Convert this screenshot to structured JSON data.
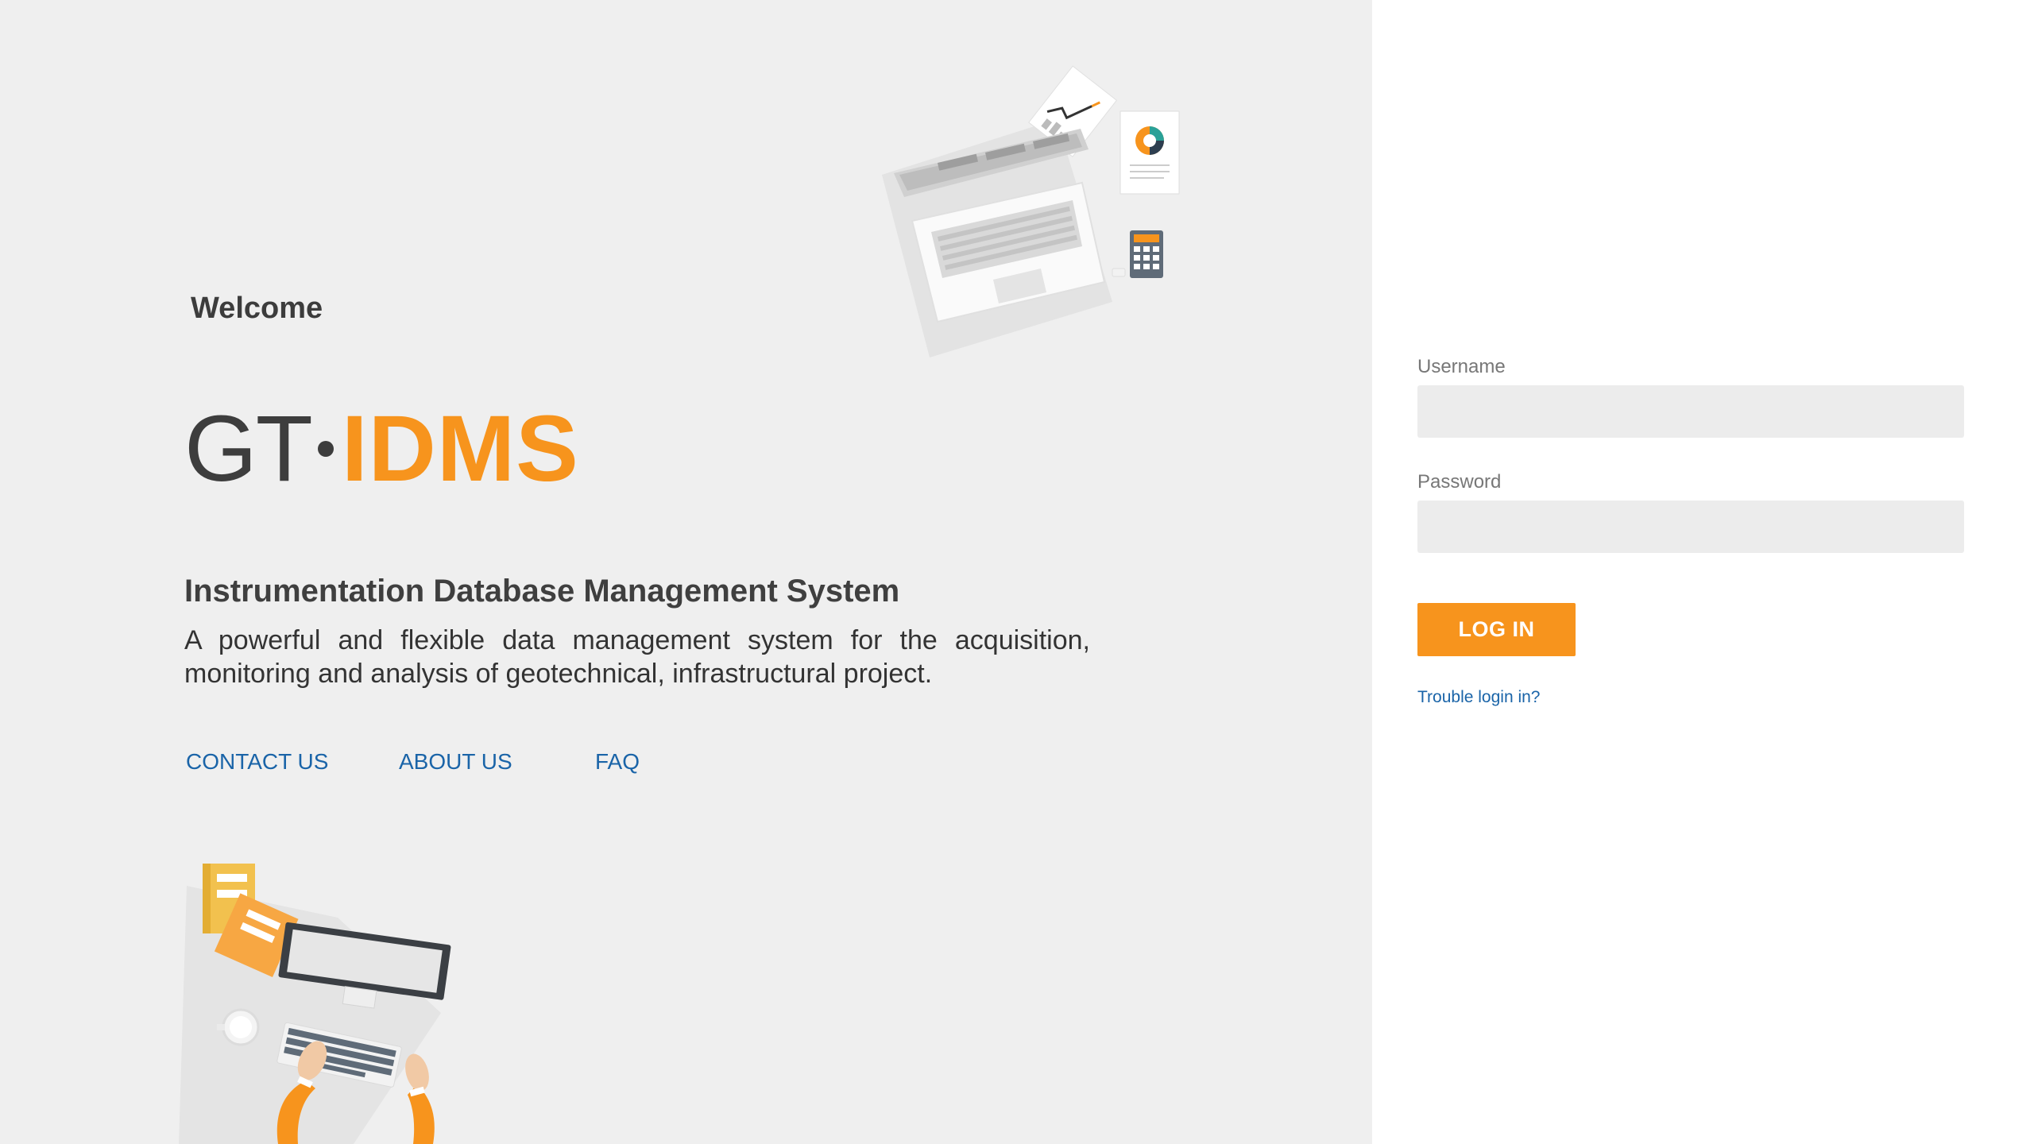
{
  "welcome": {
    "title": "Welcome"
  },
  "logo": {
    "prefix": "GT",
    "suffix": "IDMS"
  },
  "hero": {
    "subtitle": "Instrumentation Database Management System",
    "description": "A powerful and flexible data management system for the acquisition, monitoring and analysis of geotechnical, infrastructural project."
  },
  "nav": {
    "contact": "CONTACT US",
    "about": "ABOUT US",
    "faq": "FAQ"
  },
  "login": {
    "username_label": "Username",
    "username_value": "",
    "password_label": "Password",
    "password_value": "",
    "button_label": "LOG IN",
    "trouble_link": "Trouble login in?"
  },
  "colors": {
    "accent": "#f7941d",
    "link": "#1a64a8",
    "left_background": "#efefef",
    "input_background": "#ececec"
  },
  "icons": {
    "top_illustration": "laptop-with-reports-illustration",
    "bottom_illustration": "person-at-computer-illustration"
  }
}
